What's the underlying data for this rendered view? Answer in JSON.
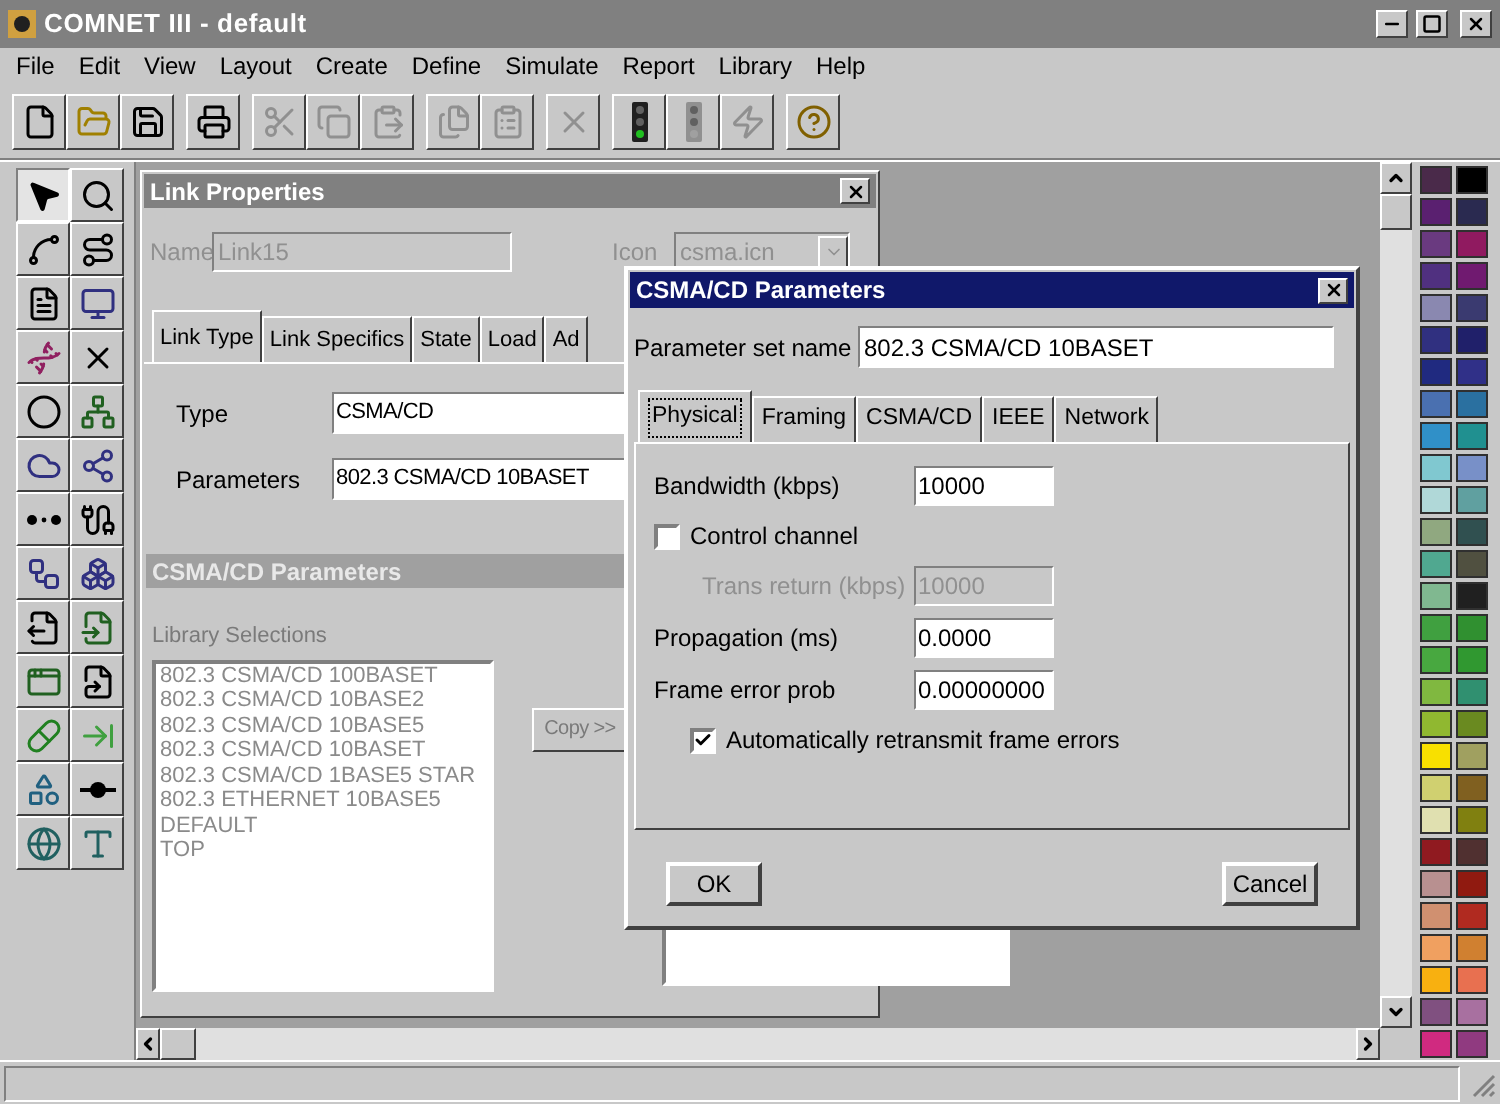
{
  "window": {
    "title": "COMNET III - default"
  },
  "menu": [
    {
      "label": "File"
    },
    {
      "label": "Edit"
    },
    {
      "label": "View"
    },
    {
      "label": "Layout"
    },
    {
      "label": "Create"
    },
    {
      "label": "Define"
    },
    {
      "label": "Simulate"
    },
    {
      "label": "Report"
    },
    {
      "label": "Library"
    },
    {
      "label": "Help"
    }
  ],
  "toolbar": [
    [
      {
        "kind": "new",
        "disabled": false
      },
      {
        "kind": "open",
        "disabled": false
      },
      {
        "kind": "save",
        "disabled": false
      }
    ],
    [
      {
        "kind": "print",
        "disabled": false
      }
    ],
    [
      {
        "kind": "cut",
        "disabled": true
      },
      {
        "kind": "copy",
        "disabled": true
      },
      {
        "kind": "paste",
        "disabled": true
      }
    ],
    [
      {
        "kind": "duplicate",
        "disabled": true
      },
      {
        "kind": "properties",
        "disabled": true
      }
    ],
    [
      {
        "kind": "delete",
        "disabled": true
      }
    ],
    [
      {
        "kind": "run",
        "disabled": false
      },
      {
        "kind": "stop",
        "disabled": true
      },
      {
        "kind": "animate",
        "disabled": true
      }
    ],
    [
      {
        "kind": "help",
        "disabled": false
      }
    ]
  ],
  "tools": [
    {
      "kind": "pointer",
      "selected": true
    },
    {
      "kind": "zoom",
      "selected": false
    },
    {
      "kind": "link",
      "selected": false
    },
    {
      "kind": "route",
      "selected": false
    },
    {
      "kind": "document",
      "selected": false
    },
    {
      "kind": "computer",
      "selected": false
    },
    {
      "kind": "connector",
      "selected": false
    },
    {
      "kind": "switch",
      "selected": false
    },
    {
      "kind": "node",
      "selected": false
    },
    {
      "kind": "router",
      "selected": false
    },
    {
      "kind": "cloud",
      "selected": false
    },
    {
      "kind": "network",
      "selected": false
    },
    {
      "kind": "chain",
      "selected": false
    },
    {
      "kind": "cable",
      "selected": false
    },
    {
      "kind": "bus",
      "selected": false
    },
    {
      "kind": "star",
      "selected": false
    },
    {
      "kind": "import",
      "selected": false
    },
    {
      "kind": "convert",
      "selected": false
    },
    {
      "kind": "window",
      "selected": false
    },
    {
      "kind": "export",
      "selected": false
    },
    {
      "kind": "pipe",
      "selected": false
    },
    {
      "kind": "arrow",
      "selected": false
    },
    {
      "kind": "shapes",
      "selected": false
    },
    {
      "kind": "junction",
      "selected": false
    },
    {
      "kind": "globe",
      "selected": false
    },
    {
      "kind": "text",
      "selected": false
    }
  ],
  "link_properties": {
    "title": "Link Properties",
    "name": {
      "label": "Name",
      "value": "Link15",
      "disabled": true
    },
    "icon": {
      "label": "Icon",
      "value": "csma.icn",
      "disabled": true
    },
    "tabs": [
      {
        "label": "Link Type",
        "selected": true
      },
      {
        "label": "Link Specifics",
        "selected": false
      },
      {
        "label": "State",
        "selected": false
      },
      {
        "label": "Load",
        "selected": false
      },
      {
        "label": "Ad",
        "selected": false
      }
    ],
    "type": {
      "label": "Type",
      "value": "CSMA/CD"
    },
    "parameters": {
      "label": "Parameters",
      "value": "802.3 CSMA/CD 10BASET"
    },
    "section_title": "CSMA/CD Parameters",
    "library": {
      "label": "Library Selections",
      "disabled": true,
      "items": [
        "802.3 CSMA/CD 100BASET",
        "802.3 CSMA/CD 10BASE2",
        "802.3 CSMA/CD 10BASE5",
        "802.3 CSMA/CD 10BASET",
        "802.3 CSMA/CD 1BASE5 STAR",
        "802.3 ETHERNET 10BASE5",
        "DEFAULT",
        "TOP"
      ]
    },
    "copy_button": {
      "label": "Copy >>",
      "disabled": true
    }
  },
  "dialog": {
    "title": "CSMA/CD Parameters",
    "set_name": {
      "label": "Parameter set name",
      "value": "802.3 CSMA/CD 10BASET"
    },
    "tabs": [
      {
        "label": "Physical",
        "selected": true
      },
      {
        "label": "Framing",
        "selected": false
      },
      {
        "label": "CSMA/CD",
        "selected": false
      },
      {
        "label": "IEEE",
        "selected": false
      },
      {
        "label": "Network",
        "selected": false
      }
    ],
    "rows": [
      {
        "kind": "field",
        "label": "Bandwidth (kbps)",
        "value": "10000",
        "disabled": false
      },
      {
        "kind": "checkbox",
        "label": "Control channel",
        "checked": false
      },
      {
        "kind": "field",
        "label": "Trans return (kbps)",
        "value": "10000",
        "disabled": true
      },
      {
        "kind": "field",
        "label": "Propagation (ms)",
        "value": "0.0000",
        "disabled": false
      },
      {
        "kind": "field",
        "label": "Frame error prob",
        "value": "0.00000000",
        "disabled": false
      },
      {
        "kind": "option",
        "label": "Automatically retransmit frame errors",
        "checked": true
      }
    ],
    "buttons": [
      "OK",
      "Cancel"
    ]
  },
  "palette": [
    {
      "color": "#4a2a4a"
    },
    {
      "color": "#000000"
    },
    {
      "color": "#5a2070"
    },
    {
      "color": "#2a2a50"
    },
    {
      "color": "#6a3a80"
    },
    {
      "color": "#901a60"
    },
    {
      "color": "#503080"
    },
    {
      "color": "#701a70"
    },
    {
      "color": "#8a88b0"
    },
    {
      "color": "#3a3a70"
    },
    {
      "color": "#303080"
    },
    {
      "color": "#20206a"
    },
    {
      "color": "#202a80"
    },
    {
      "color": "#303088"
    },
    {
      "color": "#4a70b0"
    },
    {
      "color": "#2a70a0"
    },
    {
      "color": "#3090c8"
    },
    {
      "color": "#209090"
    },
    {
      "color": "#80c8d0"
    },
    {
      "color": "#7890c8"
    },
    {
      "color": "#b0d8d8"
    },
    {
      "color": "#60a0a0"
    },
    {
      "color": "#90a880"
    },
    {
      "color": "#305050"
    },
    {
      "color": "#50a890"
    },
    {
      "color": "#505040"
    },
    {
      "color": "#80b890"
    },
    {
      "color": "#202020"
    },
    {
      "color": "#40a040"
    },
    {
      "color": "#309030"
    },
    {
      "color": "#48a840"
    },
    {
      "color": "#309830"
    },
    {
      "color": "#80b840"
    },
    {
      "color": "#309070"
    },
    {
      "color": "#90b830"
    },
    {
      "color": "#6a8a20"
    },
    {
      "color": "#f8e000"
    },
    {
      "color": "#a0a060"
    },
    {
      "color": "#d0d070"
    },
    {
      "color": "#806020"
    },
    {
      "color": "#e0e0b0"
    },
    {
      "color": "#808010"
    },
    {
      "color": "#901a20"
    },
    {
      "color": "#503030"
    },
    {
      "color": "#b89090"
    },
    {
      "color": "#901a10"
    },
    {
      "color": "#d09070"
    },
    {
      "color": "#b02a20"
    },
    {
      "color": "#f0a060"
    },
    {
      "color": "#d08030"
    },
    {
      "color": "#f8b010"
    },
    {
      "color": "#e87050"
    },
    {
      "color": "#805080"
    },
    {
      "color": "#a870a0"
    },
    {
      "color": "#d02a80"
    },
    {
      "color": "#903a80"
    }
  ]
}
